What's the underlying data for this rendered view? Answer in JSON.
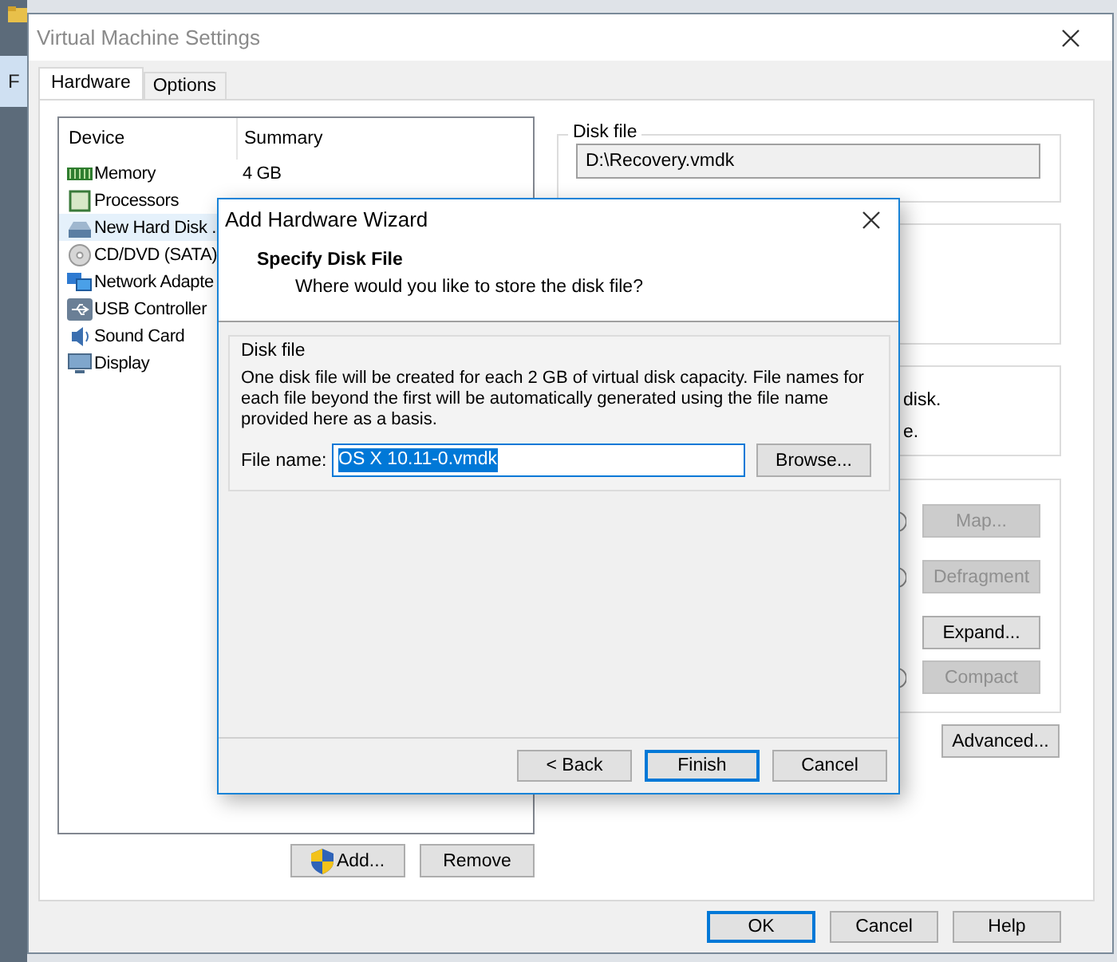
{
  "background_window": {
    "text": "F"
  },
  "window": {
    "title": "Virtual Machine Settings"
  },
  "tabs": [
    {
      "label": "Hardware",
      "selected": true
    },
    {
      "label": "Options",
      "selected": false
    }
  ],
  "device_table": {
    "columns": [
      "Device",
      "Summary"
    ],
    "rows": [
      {
        "kind": "memory",
        "device": "Memory",
        "summary": "4 GB",
        "selected": false
      },
      {
        "kind": "processor",
        "device": "Processors",
        "selected": false
      },
      {
        "kind": "disk",
        "device": "New Hard Disk .",
        "selected": true
      },
      {
        "kind": "cd",
        "device": "CD/DVD (SATA)",
        "selected": false
      },
      {
        "kind": "network",
        "device": "Network Adapte",
        "selected": false
      },
      {
        "kind": "usb",
        "device": "USB Controller",
        "selected": false
      },
      {
        "kind": "sound",
        "device": "Sound Card",
        "selected": false
      },
      {
        "kind": "display",
        "device": "Display",
        "selected": false
      }
    ]
  },
  "device_buttons": [
    {
      "label": "Add...",
      "shield": true
    },
    {
      "label": "Remove",
      "shield": false
    }
  ],
  "disk_file": {
    "legend": "Disk file",
    "value": "D:\\Recovery.vmdk"
  },
  "info_group": {
    "lines": [
      "disk.",
      "e."
    ]
  },
  "utilities": [
    {
      "kind": "radio-row",
      "label": "Map...",
      "disabled": true,
      "checked": false
    },
    {
      "kind": "radio-row",
      "label": "Defragment",
      "disabled": true,
      "checked": false
    },
    {
      "kind": "button-row",
      "label": "Expand...",
      "disabled": false
    },
    {
      "kind": "radio-row",
      "label": "Compact",
      "disabled": true,
      "checked": false
    }
  ],
  "advanced_button": "Advanced...",
  "footer_buttons": [
    {
      "label": "OK",
      "default": true
    },
    {
      "label": "Cancel",
      "default": false
    },
    {
      "label": "Help",
      "default": false
    }
  ],
  "wizard": {
    "title": "Add Hardware Wizard",
    "heading": "Specify Disk File",
    "subheading": "Where would you like to store the disk file?",
    "group": {
      "legend": "Disk file",
      "description": "One disk file will be created for each 2 GB of virtual disk capacity. File names for each file beyond the first will be automatically generated using the file name provided here as a basis.",
      "field_label": "File name:",
      "field_value": "OS X 10.11-0.vmdk",
      "field_selected": true,
      "browse": "Browse..."
    },
    "buttons": [
      {
        "label": "< Back",
        "default": false
      },
      {
        "label": "Finish",
        "default": true
      },
      {
        "label": "Cancel",
        "default": false
      }
    ]
  }
}
